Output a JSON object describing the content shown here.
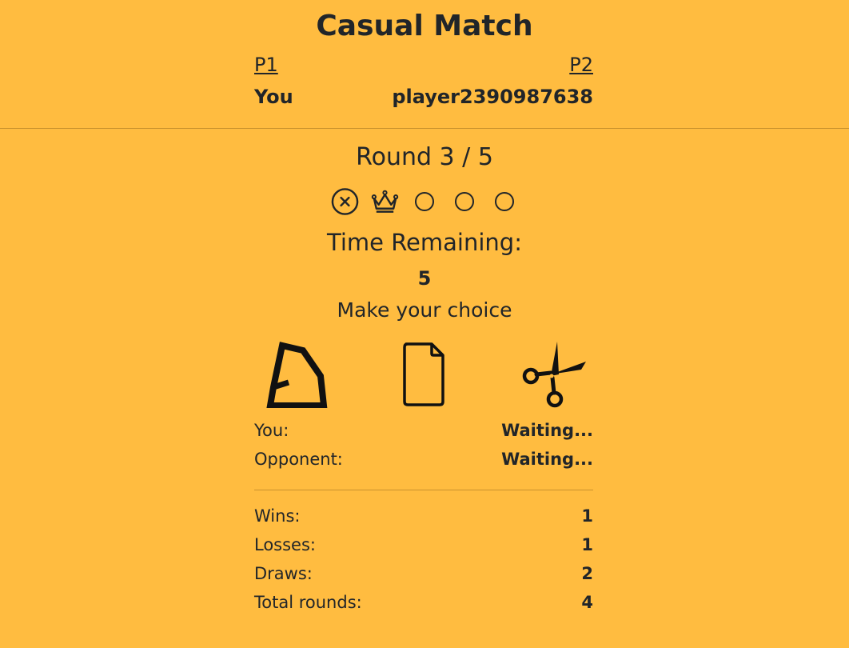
{
  "header": {
    "title": "Casual Match",
    "p1_label": "P1",
    "p2_label": "P2",
    "p1_name": "You",
    "p2_name": "player2390987638"
  },
  "round": {
    "label": "Round 3 / 5",
    "results": [
      "loss-icon",
      "win-crown-icon",
      "pending-circle-icon",
      "pending-circle-icon",
      "pending-circle-icon"
    ]
  },
  "timer": {
    "label": "Time Remaining:",
    "value": "5"
  },
  "prompt": "Make your choice",
  "choices": [
    {
      "name": "rock",
      "icon": "rock-icon"
    },
    {
      "name": "paper",
      "icon": "paper-icon"
    },
    {
      "name": "scissors",
      "icon": "scissors-icon"
    }
  ],
  "status": {
    "you_label": "You:",
    "you_value": "Waiting...",
    "opponent_label": "Opponent:",
    "opponent_value": "Waiting..."
  },
  "stats": {
    "wins_label": "Wins:",
    "wins": "1",
    "losses_label": "Losses:",
    "losses": "1",
    "draws_label": "Draws:",
    "draws": "2",
    "total_label": "Total rounds:",
    "total": "4"
  },
  "colors": {
    "background": "#ffbc40",
    "text": "#212529",
    "divider": "#c9922c"
  }
}
